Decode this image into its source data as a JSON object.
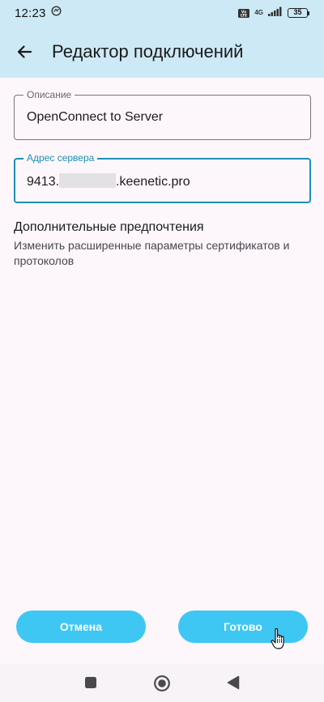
{
  "status_bar": {
    "time": "12:23",
    "volte": "Vo LTE",
    "network": "4G",
    "battery": "35"
  },
  "app_bar": {
    "title": "Редактор подключений",
    "back_icon": "arrow-back-icon"
  },
  "form": {
    "description": {
      "label": "Описание",
      "value": "OpenConnect to Server"
    },
    "server_address": {
      "label": "Адрес сервера",
      "value_prefix": "9413.",
      "value_suffix": ".keenetic.pro"
    }
  },
  "preferences": {
    "title": "Дополнительные предпочтения",
    "subtitle": "Изменить расширенные параметры сертификатов и протоколов"
  },
  "buttons": {
    "cancel": "Отмена",
    "done": "Готово"
  },
  "colors": {
    "app_bar": "#cde9f6",
    "accent": "#1e8fb3",
    "button": "#3fc7f4",
    "background": "#fdf7fb"
  }
}
